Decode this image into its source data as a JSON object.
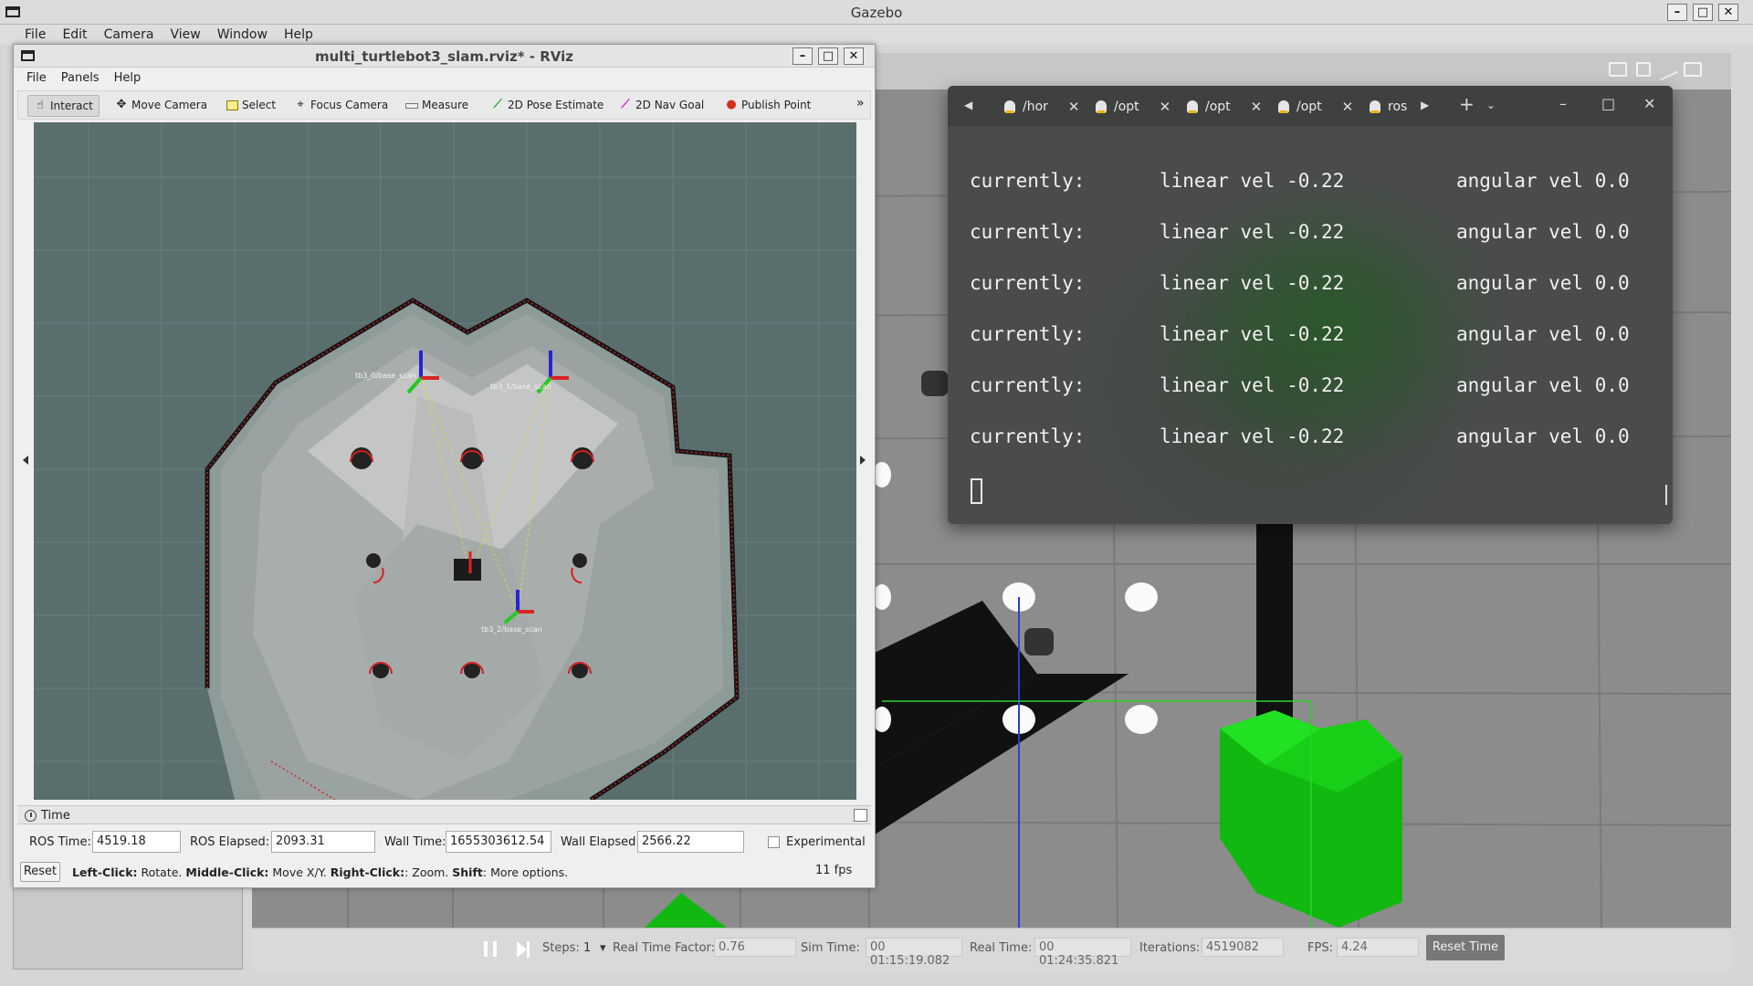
{
  "gazebo": {
    "title": "Gazebo",
    "menu": [
      "File",
      "Edit",
      "Camera",
      "View",
      "Window",
      "Help"
    ],
    "bottom": {
      "steps_label": "Steps:",
      "steps_value": "1",
      "rtf_label": "Real Time Factor:",
      "rtf_value": "0.76",
      "sim_label": "Sim Time:",
      "sim_value": "00 01:15:19.082",
      "real_label": "Real Time:",
      "real_value": "00 01:24:35.821",
      "iter_label": "Iterations:",
      "iter_value": "4519082",
      "fps_label": "FPS:",
      "fps_value": "4.24",
      "reset_time": "Reset Time"
    },
    "toolbar_icons": [
      "camera-icon",
      "save-icon",
      "plot-icon",
      "video-icon"
    ]
  },
  "rviz": {
    "title": "multi_turtlebot3_slam.rviz* - RViz",
    "menu": [
      "File",
      "Panels",
      "Help"
    ],
    "tools": [
      {
        "label": "Interact",
        "icon": "cursor-icon"
      },
      {
        "label": "Move Camera",
        "icon": "move-camera-icon"
      },
      {
        "label": "Select",
        "icon": "select-icon"
      },
      {
        "label": "Focus Camera",
        "icon": "focus-icon"
      },
      {
        "label": "Measure",
        "icon": "ruler-icon"
      },
      {
        "label": "2D Pose Estimate",
        "icon": "pose-arrow-icon"
      },
      {
        "label": "2D Nav Goal",
        "icon": "goal-arrow-icon"
      },
      {
        "label": "Publish Point",
        "icon": "pin-icon"
      }
    ],
    "time_panel": {
      "title": "Time",
      "ros_time_label": "ROS Time:",
      "ros_time": "4519.18",
      "ros_elapsed_label": "ROS Elapsed:",
      "ros_elapsed": "2093.31",
      "wall_time_label": "Wall Time:",
      "wall_time": "1655303612.54",
      "wall_elapsed_label": "Wall Elapsed:",
      "wall_elapsed": "2566.22",
      "experimental": "Experimental"
    },
    "reset": "Reset",
    "hint": {
      "left": "Left-Click:",
      "left_text": " Rotate. ",
      "middle": "Middle-Click:",
      "middle_text": " Move X/Y. ",
      "right": "Right-Click:",
      "right_text": ": Zoom. ",
      "shift": "Shift",
      "shift_text": ": More options."
    },
    "fps": "11 fps",
    "robot_labels": {
      "r1": "tb3_0/base_scan",
      "r2": "tb3_1/base_scan",
      "r3": "tb3_2/base_scan"
    }
  },
  "terminal": {
    "tabs": [
      "/hor",
      "/opt",
      "/opt",
      "/opt",
      "ros"
    ],
    "lines": [
      {
        "a": "currently:",
        "b": "linear vel -0.22",
        "c": "angular vel 0.0"
      },
      {
        "a": "currently:",
        "b": "linear vel -0.22",
        "c": "angular vel 0.0"
      },
      {
        "a": "currently:",
        "b": "linear vel -0.22",
        "c": "angular vel 0.0"
      },
      {
        "a": "currently:",
        "b": "linear vel -0.22",
        "c": "angular vel 0.0"
      },
      {
        "a": "currently:",
        "b": "linear vel -0.22",
        "c": "angular vel 0.0"
      },
      {
        "a": "currently:",
        "b": "linear vel -0.22",
        "c": "angular vel 0.0"
      }
    ]
  }
}
